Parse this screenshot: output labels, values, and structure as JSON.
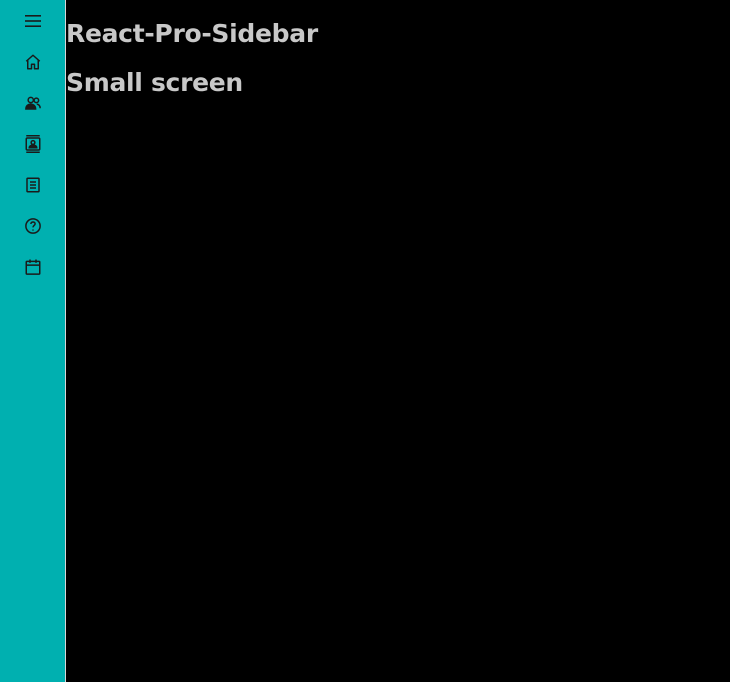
{
  "sidebar": {
    "background_color": "#00b0b0",
    "toggle_icon": "hamburger-menu-icon",
    "items": [
      {
        "icon": "home-icon"
      },
      {
        "icon": "people-icon"
      },
      {
        "icon": "contact-card-icon"
      },
      {
        "icon": "receipt-icon"
      },
      {
        "icon": "help-circle-icon"
      },
      {
        "icon": "calendar-icon"
      }
    ]
  },
  "main": {
    "title": "React-Pro-Sidebar",
    "subtitle": "Small screen",
    "background_color": "#000000",
    "text_color": "#c8c8c8"
  }
}
